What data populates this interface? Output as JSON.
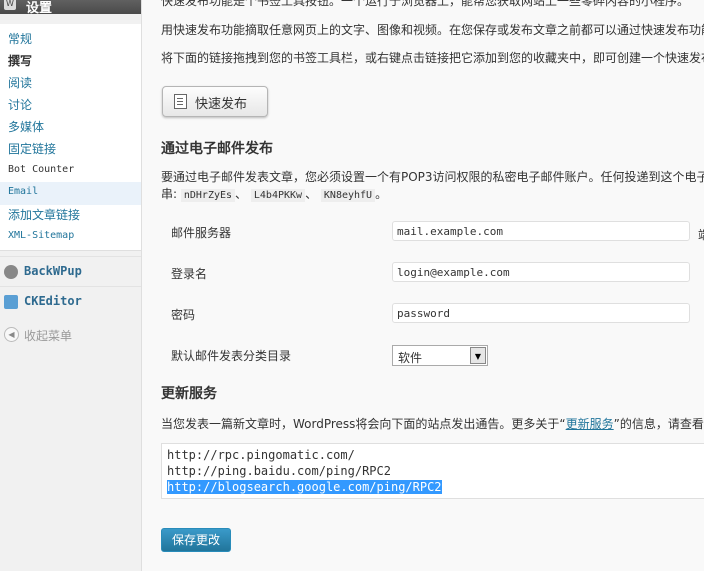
{
  "sidebar": {
    "title": "设置",
    "items": [
      {
        "label": "常规"
      },
      {
        "label": "撰写"
      },
      {
        "label": "阅读"
      },
      {
        "label": "讨论"
      },
      {
        "label": "多媒体"
      },
      {
        "label": "固定链接"
      },
      {
        "label": "Bot Counter"
      },
      {
        "label": "Email"
      },
      {
        "label": "添加文章链接"
      },
      {
        "label": "XML-Sitemap"
      }
    ],
    "plugins": [
      {
        "label": "BackWPup",
        "icon": "backwpup-icon"
      },
      {
        "label": "CKEditor",
        "icon": "ckeditor-icon"
      }
    ],
    "collapse_label": "收起菜单"
  },
  "main": {
    "p_top": "快速发布功能是个书签工具按钮。一个运行于浏览器上，能帮您获取网站上一些零碎内容的小程序。",
    "p1": "用快速发布功能摘取任意网页上的文字、图像和视频。在您保存或发布文章之前都可以通过快速发布功能",
    "p2": "将下面的链接拖拽到您的书签工具栏，或右键点击链接把它添加到您的收藏夹中，即可创建一个快速发布",
    "press_button": "快速发布",
    "email_heading": "通过电子邮件发布",
    "email_desc": "要通过电子邮件发表文章，您必须设置一个有POP3访问权限的私密电子邮件账户。任何投递到这个电子邮",
    "keys_prefix": "串:",
    "keys": [
      "nDHrZyEs",
      "L4b4PKKw",
      "KN8eyhfU"
    ],
    "key_sep": "、",
    "keys_suffix": "。",
    "mail_server": {
      "label": "邮件服务器",
      "value": "mail.example.com",
      "trail": "端"
    },
    "login": {
      "label": "登录名",
      "value": "login@example.com"
    },
    "password": {
      "label": "密码",
      "value": "password"
    },
    "category": {
      "label": "默认邮件发表分类目录",
      "value": "软件"
    },
    "update_heading": "更新服务",
    "update_desc_pre": "当您发表一篇新文章时，WordPress将会向下面的站点发出通告。更多关于“",
    "update_link": "更新服务",
    "update_desc_post": "”的信息，请查看",
    "ping_sites": [
      "http://rpc.pingomatic.com/",
      "http://ping.baidu.com/ping/RPC2",
      "http://blogsearch.google.com/ping/RPC2"
    ],
    "save_button": "保存更改"
  }
}
